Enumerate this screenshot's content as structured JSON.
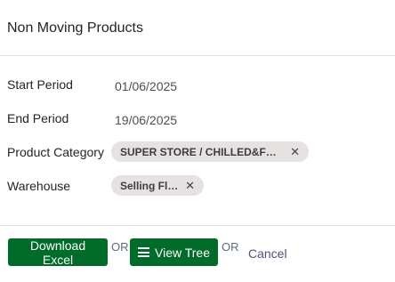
{
  "dialog": {
    "title": "Non Moving Products"
  },
  "form": {
    "start_period": {
      "label": "Start Period",
      "value": "01/06/2025"
    },
    "end_period": {
      "label": "End Period",
      "value": "19/06/2025"
    },
    "product_category": {
      "label": "Product Category",
      "tag": "SUPER STORE / CHILLED&FROZ…"
    },
    "warehouse": {
      "label": "Warehouse",
      "tag": "Selling Floor"
    }
  },
  "footer": {
    "download_label": "Download Excel",
    "or1": "OR",
    "view_tree_label": "View Tree",
    "or2": "OR",
    "cancel_label": "Cancel"
  },
  "colors": {
    "primary_button": "#016b2a",
    "link": "#5e4a7e",
    "tag_bg": "#e6e2e2"
  },
  "icons": {
    "remove": "close-icon",
    "view_tree": "list-icon"
  }
}
